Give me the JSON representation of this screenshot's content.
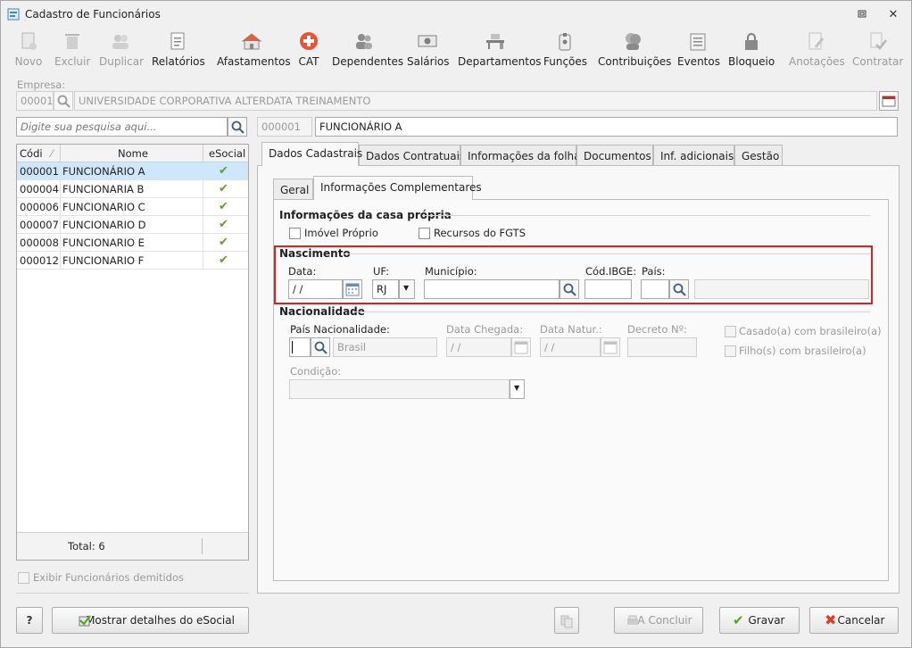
{
  "window": {
    "title": "Cadastro de Funcionários"
  },
  "toolbar": [
    {
      "label": "Novo",
      "icon": "new-icon",
      "enabled": false
    },
    {
      "label": "Excluir",
      "icon": "trash-icon",
      "enabled": false
    },
    {
      "label": "Duplicar",
      "icon": "duplicate-icon",
      "enabled": false
    },
    {
      "label": "Relatórios",
      "icon": "report-icon",
      "enabled": true
    },
    {
      "label": "Afastamentos",
      "icon": "house-icon",
      "enabled": true
    },
    {
      "label": "CAT",
      "icon": "medical-cross-icon",
      "enabled": true
    },
    {
      "label": "Dependentes",
      "icon": "people-icon",
      "enabled": true
    },
    {
      "label": "Salários",
      "icon": "money-icon",
      "enabled": true
    },
    {
      "label": "Departamentos",
      "icon": "desk-icon",
      "enabled": true
    },
    {
      "label": "Funções",
      "icon": "badge-icon",
      "enabled": true
    },
    {
      "label": "Contribuições",
      "icon": "contributors-icon",
      "enabled": true
    },
    {
      "label": "Eventos",
      "icon": "list-icon",
      "enabled": true
    },
    {
      "label": "Bloqueio",
      "icon": "lock-icon",
      "enabled": true
    },
    {
      "label": "Anotações",
      "icon": "notes-icon",
      "enabled": false
    },
    {
      "label": "Contratar",
      "icon": "hire-icon",
      "enabled": false
    }
  ],
  "empresa": {
    "label": "Empresa:",
    "code": "00001",
    "name": "UNIVERSIDADE CORPORATIVA ALTERDATA TREINAMENTO"
  },
  "search": {
    "placeholder": "Digite sua pesquisa aqui..."
  },
  "employee": {
    "code": "000001",
    "name": "FUNCIONÁRIO A"
  },
  "grid": {
    "columns": [
      "Códi",
      "Nome",
      "eSocial"
    ],
    "rows": [
      {
        "code": "000001",
        "name": "FUNCIONÁRIO A",
        "esocial": "✔"
      },
      {
        "code": "000004",
        "name": "FUNCIONARIA B",
        "esocial": "✔"
      },
      {
        "code": "000006",
        "name": "FUNCIONARIO C",
        "esocial": "✔"
      },
      {
        "code": "000007",
        "name": "FUNCIONARIO D",
        "esocial": "✔"
      },
      {
        "code": "000008",
        "name": "FUNCIONARIO E",
        "esocial": "✔"
      },
      {
        "code": "000012",
        "name": "FUNCIONARIO F",
        "esocial": "✔"
      }
    ],
    "total": "Total: 6"
  },
  "show_dismissed": "Exibir Funcionários demitidos",
  "tabs": [
    "Dados Cadastrais",
    "Dados Contratuais",
    "Informações da folha",
    "Documentos",
    "Inf. adicionais",
    "Gestão"
  ],
  "subtabs": [
    "Geral",
    "Informações Complementares"
  ],
  "casa_propria": {
    "title": "Informações da casa própria",
    "imovel": "Imóvel Próprio",
    "fgts": "Recursos do FGTS"
  },
  "nascimento": {
    "title": "Nascimento",
    "data_label": "Data:",
    "data_value": " /  /",
    "uf_label": "UF:",
    "uf_value": "RJ",
    "municipio_label": "Município:",
    "ibge_label": "Cód.IBGE:",
    "pais_label": "País:"
  },
  "nacionalidade": {
    "title": "Nacionalidade",
    "pais_label": "País Nacionalidade:",
    "pais_value": "Brasil",
    "chegada_label": "Data Chegada:",
    "chegada_value": " /  /",
    "natur_label": "Data Natur.:",
    "natur_value": " /  /",
    "decreto_label": "Decreto Nº:",
    "casado": "Casado(a) com brasileiro(a)",
    "filho": "Filho(s) com brasileiro(a)",
    "condicao_label": "Condição:"
  },
  "footer": {
    "help": "?",
    "esocial_details": "Mostrar detalhes do eSocial",
    "concluir": "A Concluir",
    "gravar": "Gravar",
    "cancelar": "Cancelar"
  },
  "colors": {
    "highlight": "#e02020",
    "selection": "#cfe6fb",
    "check": "#5aa31e"
  }
}
